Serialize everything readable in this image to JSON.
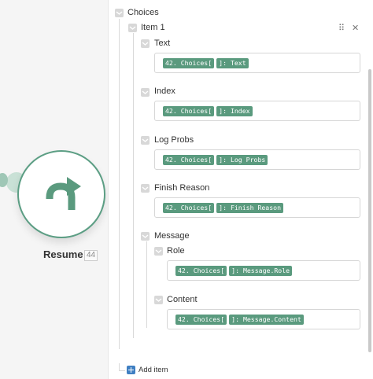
{
  "node": {
    "label": "Resume",
    "badge": "44",
    "icon": "redo-arrow-icon",
    "accent": "#5c9e84"
  },
  "panel": {
    "root_label": "Choices",
    "item": {
      "label": "Item 1",
      "tools": {
        "drag": "⠿",
        "close": "✕"
      },
      "fields": [
        {
          "label": "Text",
          "pills": [
            "42. Choices[",
            "]: Text"
          ]
        },
        {
          "label": "Index",
          "pills": [
            "42. Choices[",
            "]: Index"
          ]
        },
        {
          "label": "Log Probs",
          "pills": [
            "42. Choices[",
            "]: Log Probs"
          ]
        },
        {
          "label": "Finish Reason",
          "pills": [
            "42. Choices[",
            "]: Finish Reason"
          ]
        }
      ],
      "message": {
        "label": "Message",
        "fields": [
          {
            "label": "Role",
            "pills": [
              "42. Choices[",
              "]: Message.Role"
            ]
          },
          {
            "label": "Content",
            "pills": [
              "42. Choices[",
              "]: Message.Content"
            ]
          }
        ]
      }
    },
    "add_item": "Add item"
  },
  "colors": {
    "pill": "#5a9a7e",
    "add_icon": "#3f7fc2"
  }
}
